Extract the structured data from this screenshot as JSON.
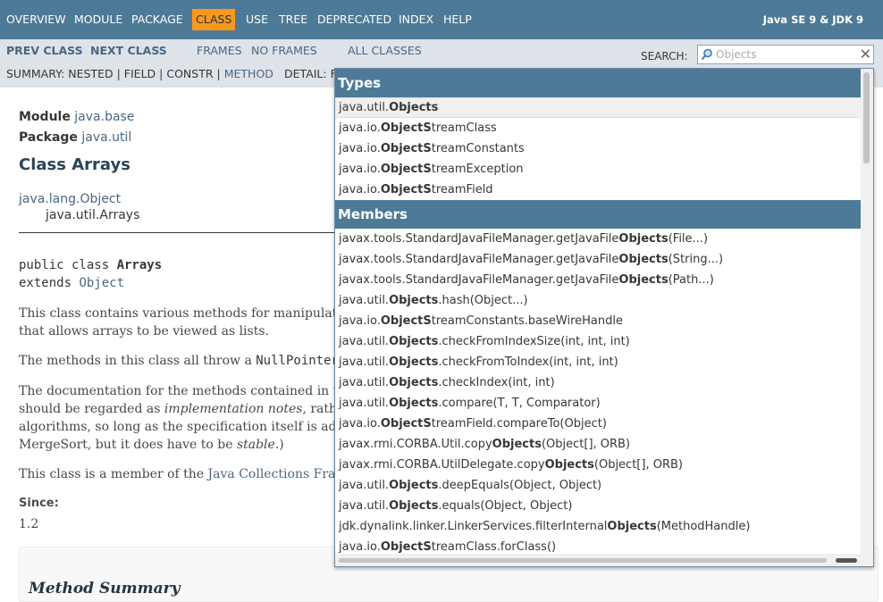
{
  "topnav": {
    "items": [
      "OVERVIEW",
      "MODULE",
      "PACKAGE",
      "CLASS",
      "USE",
      "TREE",
      "DEPRECATED",
      "INDEX",
      "HELP"
    ],
    "active": "CLASS",
    "about": "Java SE 9 & JDK 9"
  },
  "subnav": {
    "prev_class": "PREV CLASS",
    "next_class": "NEXT CLASS",
    "frames": "FRAMES",
    "no_frames": "NO FRAMES",
    "all_classes": "ALL CLASSES",
    "summary_prefix": "SUMMARY:",
    "summary_nested": "NESTED",
    "summary_field": "FIELD",
    "summary_constr": "CONSTR",
    "summary_method": "METHOD",
    "sep": "|",
    "detail": "DETAIL: F"
  },
  "search": {
    "label": "SEARCH:",
    "value": "Objects",
    "clear": "✕"
  },
  "page": {
    "module_label": "Module",
    "module_link": "java.base",
    "package_label": "Package",
    "package_link": "java.util",
    "title": "Class Arrays",
    "inherit_parent": "java.lang.Object",
    "inherit_child": "java.util.Arrays",
    "decl_line1_prefix": "public class ",
    "decl_line1_name": "Arrays",
    "decl_line2_prefix": "extends ",
    "decl_line2_link": "Object",
    "para1_line1": "This class contains various methods for manipulati",
    "para1_line2": "that allows arrays to be viewed as lists.",
    "para2_prefix": "The methods in this class all throw a ",
    "para2_code": "NullPointerE",
    "para3_line1": "The documentation for the methods contained in th",
    "para3_line2_prefix": "should be regarded as ",
    "para3_line2_em": "implementation notes",
    "para3_line2_suffix": ", rathe",
    "para3_line3": "algorithms, so long as the specification itself is adh",
    "para3_line4_prefix": "MergeSort, but it does have to be ",
    "para3_line4_em": "stable",
    "para3_line4_suffix": ".)",
    "para4_prefix": "This class is a member of the ",
    "para4_link": "Java Collections Fram",
    "since_label": "Since:",
    "since_value": "1.2",
    "method_summary": "Method Summary"
  },
  "popup": {
    "types_label": "Types",
    "types": [
      {
        "pre": "java.util.",
        "match": "Objects",
        "post": ""
      },
      {
        "pre": "java.io.",
        "match": "ObjectS",
        "post": "treamClass"
      },
      {
        "pre": "java.io.",
        "match": "ObjectS",
        "post": "treamConstants"
      },
      {
        "pre": "java.io.",
        "match": "ObjectS",
        "post": "treamException"
      },
      {
        "pre": "java.io.",
        "match": "ObjectS",
        "post": "treamField"
      }
    ],
    "members_label": "Members",
    "members": [
      {
        "pre": "javax.tools.StandardJavaFileManager.getJavaFile",
        "match": "Objects",
        "post": "(File...)"
      },
      {
        "pre": "javax.tools.StandardJavaFileManager.getJavaFile",
        "match": "Objects",
        "post": "(String...)"
      },
      {
        "pre": "javax.tools.StandardJavaFileManager.getJavaFile",
        "match": "Objects",
        "post": "(Path...)"
      },
      {
        "pre": "java.util.",
        "match": "Objects",
        "post": ".hash(Object...)"
      },
      {
        "pre": "java.io.",
        "match": "ObjectS",
        "post": "treamConstants.baseWireHandle"
      },
      {
        "pre": "java.util.",
        "match": "Objects",
        "post": ".checkFromIndexSize(int, int, int)"
      },
      {
        "pre": "java.util.",
        "match": "Objects",
        "post": ".checkFromToIndex(int, int, int)"
      },
      {
        "pre": "java.util.",
        "match": "Objects",
        "post": ".checkIndex(int, int)"
      },
      {
        "pre": "java.util.",
        "match": "Objects",
        "post": ".compare(T, T, Comparator)"
      },
      {
        "pre": "java.io.",
        "match": "ObjectS",
        "post": "treamField.compareTo(Object)"
      },
      {
        "pre": "javax.rmi.CORBA.Util.copy",
        "match": "Objects",
        "post": "(Object[], ORB)"
      },
      {
        "pre": "javax.rmi.CORBA.UtilDelegate.copy",
        "match": "Objects",
        "post": "(Object[], ORB)"
      },
      {
        "pre": "java.util.",
        "match": "Objects",
        "post": ".deepEquals(Object, Object)"
      },
      {
        "pre": "java.util.",
        "match": "Objects",
        "post": ".equals(Object, Object)"
      },
      {
        "pre": "jdk.dynalink.linker.LinkerServices.filterInternal",
        "match": "Objects",
        "post": "(MethodHandle)"
      },
      {
        "pre": "java.io.",
        "match": "ObjectS",
        "post": "treamClass.forClass()"
      }
    ]
  },
  "colors": {
    "nav": "#4d7a97",
    "subnav": "#dee3e9",
    "active": "#f8981d",
    "link": "#4a6782"
  }
}
